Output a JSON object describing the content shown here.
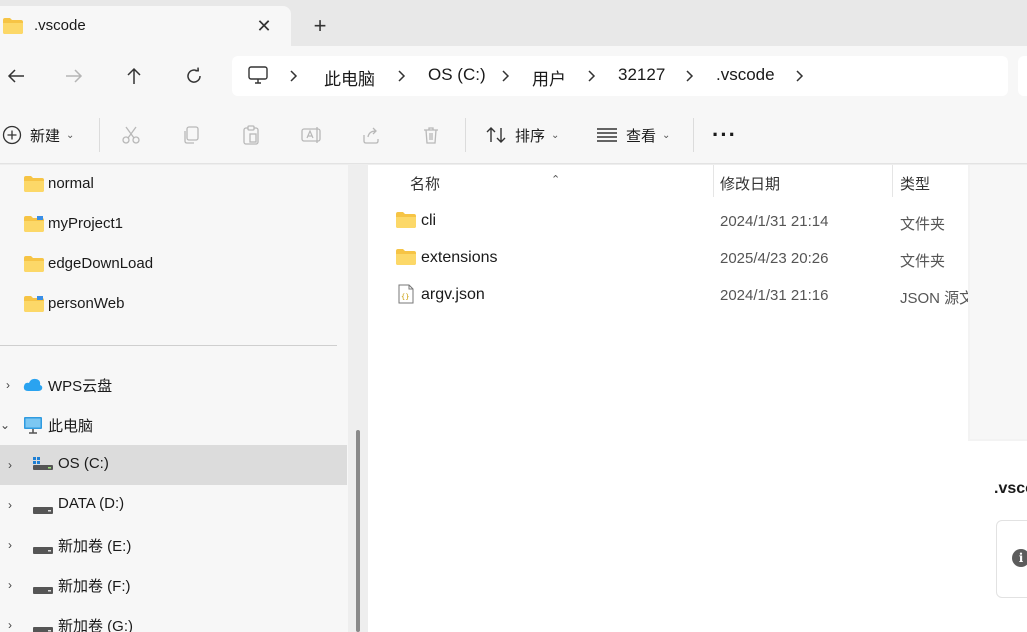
{
  "tab": {
    "title": ".vscode",
    "close": "✕",
    "new_tab": "+"
  },
  "breadcrumb": [
    "此电脑",
    "OS (C:)",
    "用户",
    "32127",
    ".vscode"
  ],
  "commands": {
    "new_label": "新建",
    "sort_label": "排序",
    "view_label": "查看",
    "more": "···"
  },
  "sidebar": {
    "quick": [
      {
        "label": "normal",
        "icon": "folder-icon"
      },
      {
        "label": "myProject1",
        "icon": "folder-icon"
      },
      {
        "label": "edgeDownLoad",
        "icon": "folder-icon"
      },
      {
        "label": "personWeb",
        "icon": "folder-icon"
      }
    ],
    "wps": "WPS云盘",
    "this_pc": "此电脑",
    "drives": [
      {
        "label": "OS (C:)",
        "selected": true
      },
      {
        "label": "DATA (D:)"
      },
      {
        "label": "新加卷 (E:)"
      },
      {
        "label": "新加卷 (F:)"
      },
      {
        "label": "新加卷 (G:)"
      }
    ]
  },
  "columns": {
    "name": "名称",
    "modified": "修改日期",
    "type": "类型"
  },
  "files": [
    {
      "name": "cli",
      "date": "2024/1/31 21:14",
      "type": "文件夹",
      "icon": "folder-icon"
    },
    {
      "name": "extensions",
      "date": "2025/4/23 20:26",
      "type": "文件夹",
      "icon": "folder-icon"
    },
    {
      "name": "argv.json",
      "date": "2024/1/31 21:16",
      "type": "JSON 源文件",
      "icon": "json-file-icon"
    }
  ],
  "details": {
    "title": ".vscode",
    "info": "i"
  },
  "colors": {
    "folder": "#f6c445",
    "selected": "#dcdcdc",
    "accent": "#0a5fb4"
  }
}
